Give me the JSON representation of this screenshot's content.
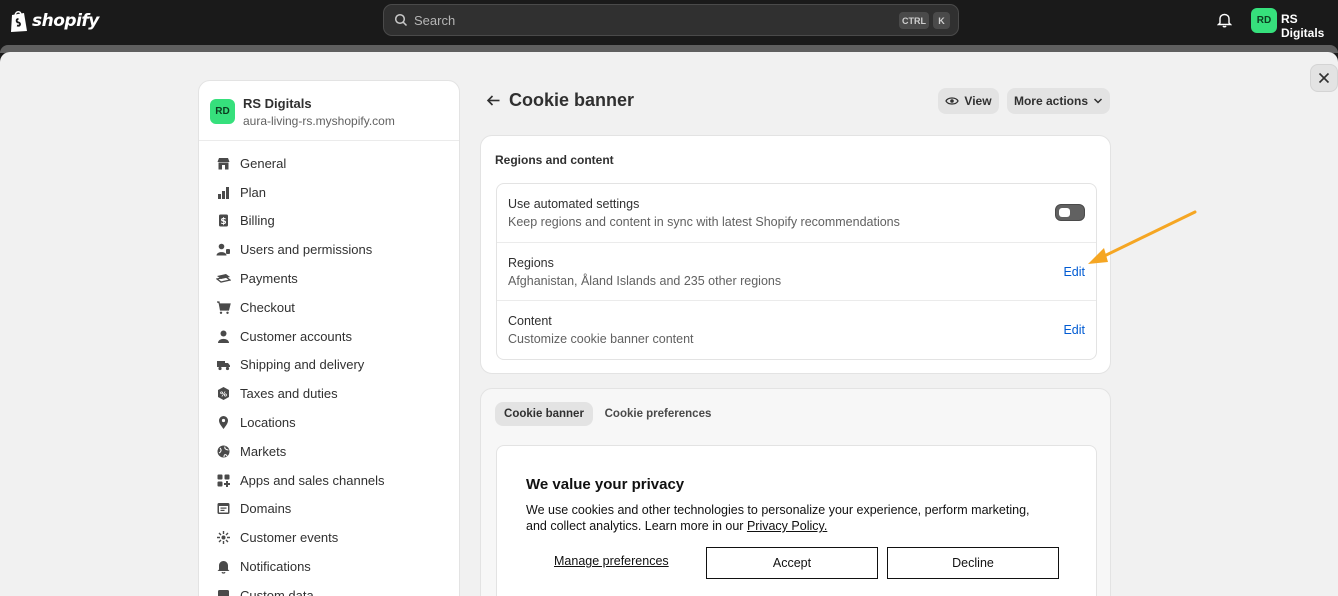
{
  "topbar": {
    "brand": "shopify",
    "search_placeholder": "Search",
    "shortcut_ctrl": "CTRL",
    "shortcut_k": "K",
    "avatar_initials": "RD",
    "store_name": "RS Digitals"
  },
  "sidebar": {
    "store": {
      "initials": "RD",
      "name": "RS Digitals",
      "url": "aura-living-rs.myshopify.com"
    },
    "items": [
      {
        "label": "General",
        "icon": "store-icon"
      },
      {
        "label": "Plan",
        "icon": "plan-icon"
      },
      {
        "label": "Billing",
        "icon": "billing-icon"
      },
      {
        "label": "Users and permissions",
        "icon": "users-icon"
      },
      {
        "label": "Payments",
        "icon": "payments-icon"
      },
      {
        "label": "Checkout",
        "icon": "cart-icon"
      },
      {
        "label": "Customer accounts",
        "icon": "person-icon"
      },
      {
        "label": "Shipping and delivery",
        "icon": "truck-icon"
      },
      {
        "label": "Taxes and duties",
        "icon": "tax-icon"
      },
      {
        "label": "Locations",
        "icon": "location-icon"
      },
      {
        "label": "Markets",
        "icon": "globe-icon"
      },
      {
        "label": "Apps and sales channels",
        "icon": "apps-icon"
      },
      {
        "label": "Domains",
        "icon": "domains-icon"
      },
      {
        "label": "Customer events",
        "icon": "events-icon"
      },
      {
        "label": "Notifications",
        "icon": "bell-icon"
      },
      {
        "label": "Custom data",
        "icon": "data-icon"
      }
    ]
  },
  "header": {
    "title": "Cookie banner",
    "view_label": "View",
    "more_actions_label": "More actions"
  },
  "regions_card": {
    "title": "Regions and content",
    "rows": [
      {
        "title": "Use automated settings",
        "desc": "Keep regions and content in sync with latest Shopify recommendations",
        "control": "toggle",
        "toggle_on": false
      },
      {
        "title": "Regions",
        "desc": "Afghanistan, Åland Islands and 235 other regions",
        "control": "Edit"
      },
      {
        "title": "Content",
        "desc": "Customize cookie banner content",
        "control": "Edit"
      }
    ]
  },
  "preview_card": {
    "tabs": [
      {
        "label": "Cookie banner",
        "active": true
      },
      {
        "label": "Cookie preferences",
        "active": false
      }
    ],
    "banner": {
      "title": "We value your privacy",
      "text": "We use cookies and other technologies to personalize your experience, perform marketing, and collect analytics. Learn more in our ",
      "link_text": "Privacy Policy.",
      "manage_label": "Manage preferences",
      "accept_label": "Accept",
      "decline_label": "Decline"
    }
  },
  "colors": {
    "accent_link": "#005bd3",
    "annotation_arrow": "#f5a623",
    "avatar_green": "#36e07c"
  }
}
